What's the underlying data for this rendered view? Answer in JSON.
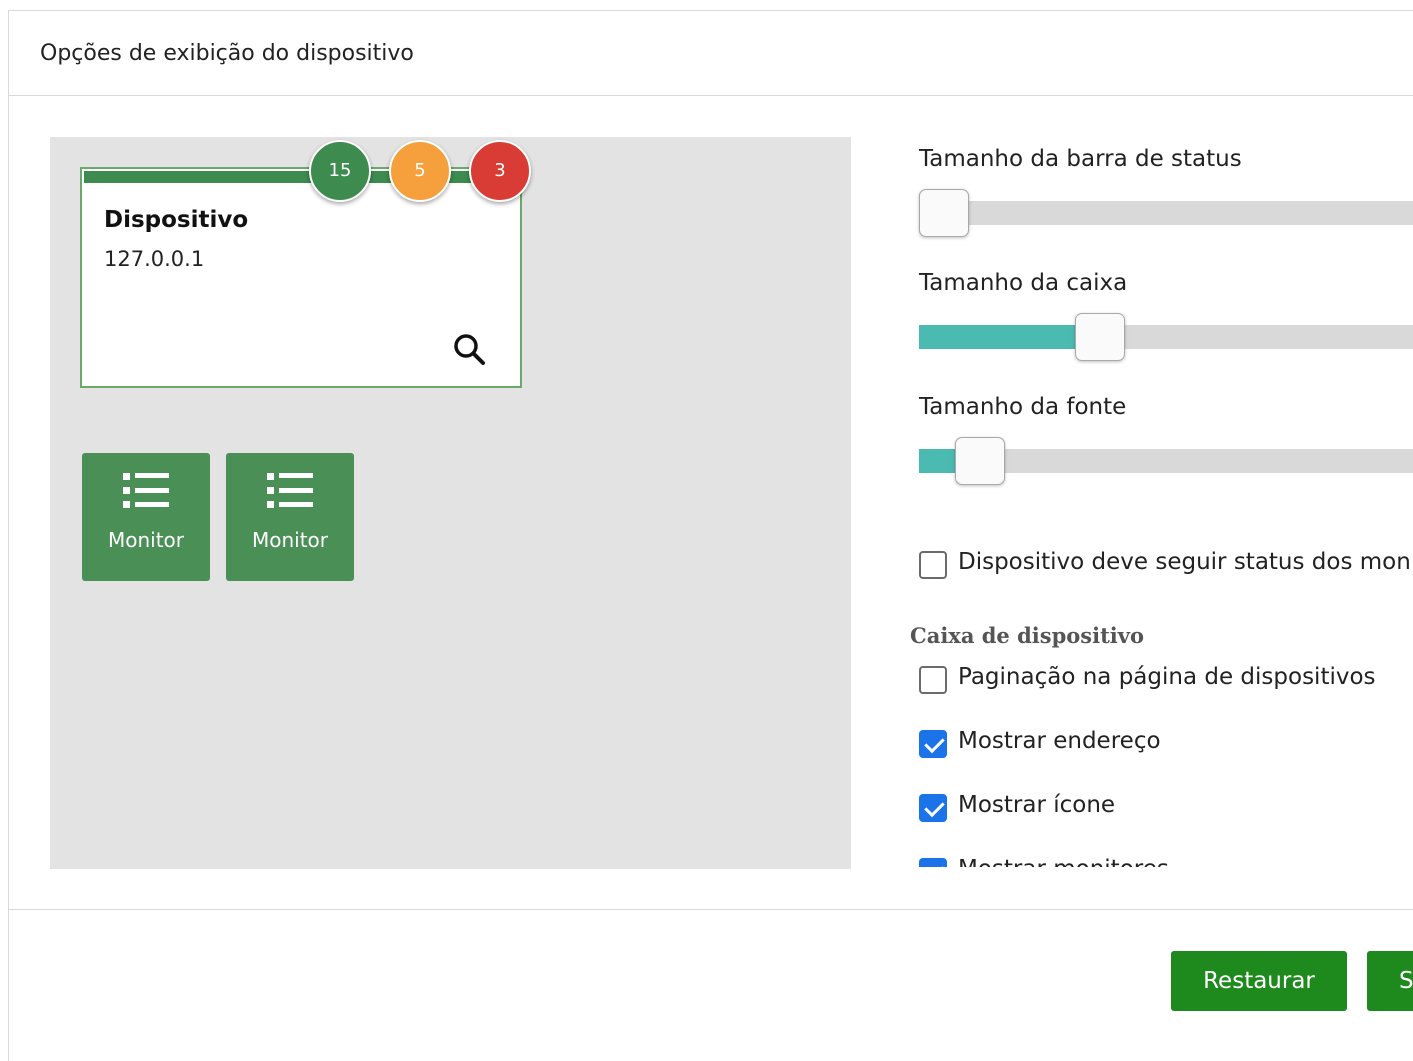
{
  "dialog": {
    "title": "Opções de exibição do dispositivo"
  },
  "preview": {
    "device_name": "Dispositivo",
    "device_address": "127.0.0.1",
    "badges": [
      {
        "value": "15",
        "color": "#3d8b4f"
      },
      {
        "value": "5",
        "color": "#f5a03c"
      },
      {
        "value": "3",
        "color": "#d93b35"
      }
    ],
    "monitors": [
      {
        "label": "Monitor",
        "icon": "list-icon"
      },
      {
        "label": "Monitor",
        "icon": "list-icon"
      }
    ]
  },
  "settings": {
    "sliders": [
      {
        "label": "Tamanho da barra de status",
        "value_fraction": 0.0
      },
      {
        "label": "Tamanho da caixa",
        "value_fraction": 0.3
      },
      {
        "label": "Tamanho da fonte",
        "value_fraction": 0.07
      }
    ],
    "follow_status": {
      "label": "Dispositivo deve seguir status dos moni",
      "checked": false
    },
    "section_title": "Caixa de dispositivo",
    "checkboxes": [
      {
        "label": "Paginação na página de dispositivos",
        "checked": false
      },
      {
        "label": "Mostrar endereço",
        "checked": true
      },
      {
        "label": "Mostrar ícone",
        "checked": true
      },
      {
        "label": "Mostrar monitores",
        "checked": true
      }
    ]
  },
  "footer": {
    "restore_label": "Restaurar",
    "save_label": "S"
  },
  "colors": {
    "accent_green": "#1e8a1e",
    "slider_fill": "#4bbbb1",
    "checkbox_blue": "#1a73e8"
  }
}
